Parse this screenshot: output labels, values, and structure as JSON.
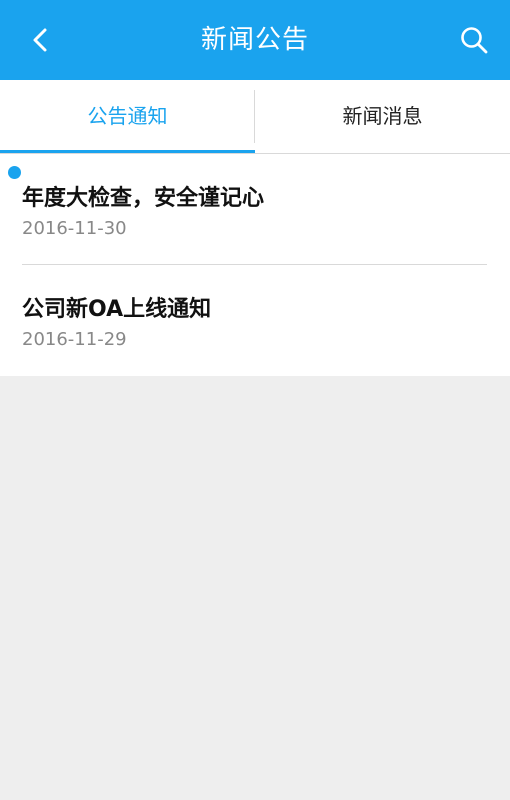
{
  "header": {
    "title": "新闻公告",
    "back_icon": "chevron-left-icon",
    "search_icon": "search-icon",
    "background_color": "#1aa3ee"
  },
  "tabs": [
    {
      "label": "公告通知",
      "active": true
    },
    {
      "label": "新闻消息",
      "active": false
    }
  ],
  "notices": [
    {
      "title": "年度大检查，安全谨记心",
      "date": "2016-11-30",
      "unread": true
    },
    {
      "title": "公司新OA上线通知",
      "date": "2016-11-29",
      "unread": false
    }
  ],
  "colors": {
    "accent": "#1aa3ee",
    "page_background": "#eeeeee"
  }
}
